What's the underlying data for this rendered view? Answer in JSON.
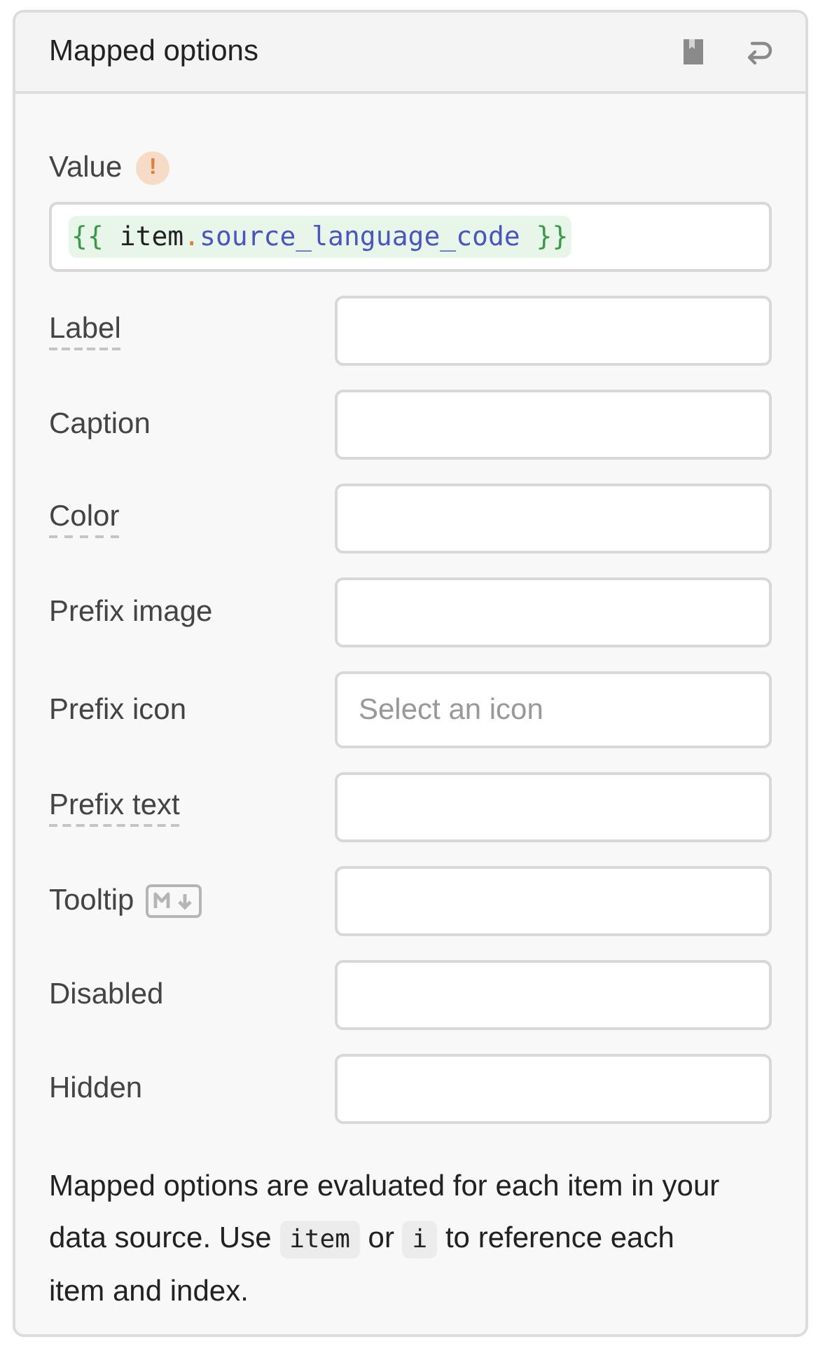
{
  "panel": {
    "title": "Mapped options"
  },
  "value_field": {
    "label": "Value",
    "warning": true,
    "warning_glyph": "!",
    "value": "{{ item.source_language_code }}"
  },
  "fields": [
    {
      "label": "Label",
      "documented": true
    },
    {
      "label": "Caption",
      "documented": false
    },
    {
      "label": "Color",
      "documented": true
    },
    {
      "label": "Prefix image",
      "documented": false
    },
    {
      "label": "Prefix icon",
      "documented": false,
      "placeholder": "Select an icon"
    },
    {
      "label": "Prefix text",
      "documented": true
    },
    {
      "label": "Tooltip",
      "documented": false,
      "markdown": true
    },
    {
      "label": "Disabled",
      "documented": false
    },
    {
      "label": "Hidden",
      "documented": false
    }
  ],
  "note": [
    {
      "kind": "text",
      "text": "Mapped options are evaluated for each item in your data source. Use "
    },
    {
      "kind": "code",
      "text": "item"
    },
    {
      "kind": "text",
      "text": " or "
    },
    {
      "kind": "code",
      "text": "i"
    },
    {
      "kind": "text",
      "text": " to reference each item and index."
    }
  ]
}
